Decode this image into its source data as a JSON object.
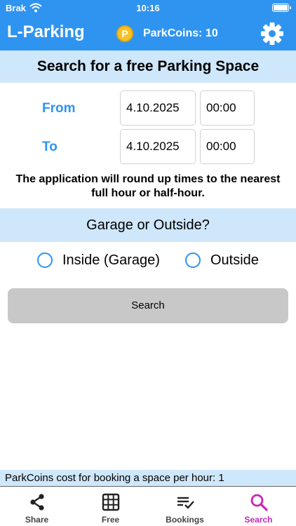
{
  "status_bar": {
    "carrier": "Brak",
    "time": "10:16"
  },
  "header": {
    "title": "L-Parking",
    "coin_symbol": "P",
    "coins_text": "ParkCoins: 10"
  },
  "search": {
    "title": "Search for a free Parking Space",
    "from_label": "From",
    "to_label": "To",
    "from_date": "4.10.2025",
    "from_time": "00:00",
    "to_date": "4.10.2025",
    "to_time": "00:00",
    "note": "The application will round up times to the nearest full hour or half-hour."
  },
  "location": {
    "title": "Garage or Outside?",
    "options": [
      {
        "label": "Inside (Garage)",
        "selected": false
      },
      {
        "label": "Outside",
        "selected": false
      }
    ]
  },
  "search_button": "Search",
  "cost_info": "ParkCoins cost for booking a space per hour: 1",
  "tabs": [
    {
      "label": "Share",
      "icon": "share-icon"
    },
    {
      "label": "Free",
      "icon": "grid-icon"
    },
    {
      "label": "Bookings",
      "icon": "checklist-icon"
    },
    {
      "label": "Search",
      "icon": "search-icon",
      "active": true
    }
  ],
  "colors": {
    "header": "#2f94f0",
    "band": "#cfe7fb",
    "accent": "#2f94f0",
    "active_tab": "#c625b8",
    "button": "#c8c8c8",
    "coin": "#f7c227"
  }
}
